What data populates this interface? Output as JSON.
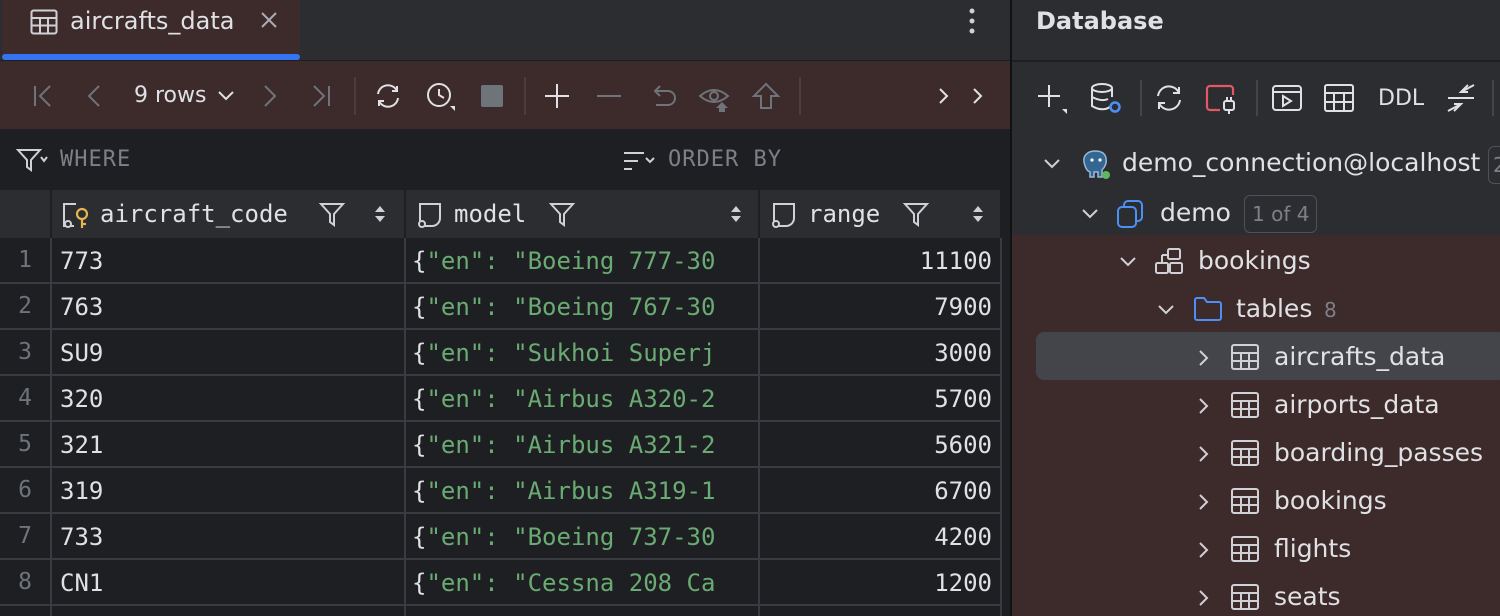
{
  "editor": {
    "tab_title": "aircrafts_data",
    "toolbar": {
      "rows_label": "9 rows"
    },
    "filter": {
      "where_label": "WHERE",
      "order_by_label": "ORDER BY"
    },
    "columns": [
      "aircraft_code",
      "model",
      "range"
    ],
    "rows": [
      {
        "num": "1",
        "aircraft_code": "773",
        "model_open": "{",
        "model_text": "\"en\": \"Boeing 777-30",
        "range": "11100"
      },
      {
        "num": "2",
        "aircraft_code": "763",
        "model_open": "{",
        "model_text": "\"en\": \"Boeing 767-30",
        "range": "7900"
      },
      {
        "num": "3",
        "aircraft_code": "SU9",
        "model_open": "{",
        "model_text": "\"en\": \"Sukhoi Superj",
        "range": "3000"
      },
      {
        "num": "4",
        "aircraft_code": "320",
        "model_open": "{",
        "model_text": "\"en\": \"Airbus A320-2",
        "range": "5700"
      },
      {
        "num": "5",
        "aircraft_code": "321",
        "model_open": "{",
        "model_text": "\"en\": \"Airbus A321-2",
        "range": "5600"
      },
      {
        "num": "6",
        "aircraft_code": "319",
        "model_open": "{",
        "model_text": "\"en\": \"Airbus A319-1",
        "range": "6700"
      },
      {
        "num": "7",
        "aircraft_code": "733",
        "model_open": "{",
        "model_text": "\"en\": \"Boeing 737-30",
        "range": "4200"
      },
      {
        "num": "8",
        "aircraft_code": "CN1",
        "model_open": "{",
        "model_text": "\"en\": \"Cessna 208 Ca",
        "range": "1200"
      }
    ]
  },
  "database_panel": {
    "title": "Database",
    "toolbar": {
      "ddl_label": "DDL"
    },
    "tree": {
      "connection": "demo_connection@localhost",
      "connection_badge": "2",
      "database": "demo",
      "database_badge": "1 of 4",
      "schema": "bookings",
      "tables_folder": "tables",
      "tables_count": "8",
      "tables": [
        "aircrafts_data",
        "airports_data",
        "boarding_passes",
        "bookings",
        "flights",
        "seats"
      ]
    }
  },
  "colors": {
    "accent": "#3574f0",
    "json_string": "#6aab73",
    "toolbar_tint": "#3d2a2a",
    "panel_bg": "#2b2d30",
    "editor_bg": "#1e1f22"
  }
}
